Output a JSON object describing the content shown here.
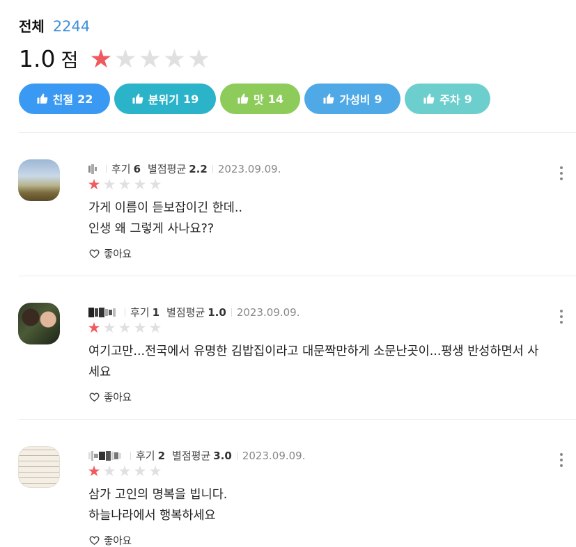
{
  "summary": {
    "total_label": "전체",
    "total_count": "2244",
    "score": "1.0",
    "score_unit": "점",
    "rating_stars": 1
  },
  "chips": [
    {
      "label": "친절",
      "count": "22",
      "color": "#3a9af3"
    },
    {
      "label": "분위기",
      "count": "19",
      "color": "#2bb3c9"
    },
    {
      "label": "맛",
      "count": "14",
      "color": "#8dcb5a"
    },
    {
      "label": "가성비",
      "count": "9",
      "color": "#4fa9e6"
    },
    {
      "label": "주차",
      "count": "9",
      "color": "#6dcfcd"
    }
  ],
  "labels": {
    "review_count": "후기",
    "avg_rating": "별점평균",
    "like": "좋아요"
  },
  "reviews": [
    {
      "review_count": "6",
      "avg_rating": "2.2",
      "date": "2023.09.09.",
      "stars": 1,
      "lines": [
        "가게 이름이 듣보잡이긴 한데..",
        "인생 왜 그렇게 사나요??"
      ]
    },
    {
      "review_count": "1",
      "avg_rating": "1.0",
      "date": "2023.09.09.",
      "stars": 1,
      "lines": [
        "여기고만...전국에서 유명한 김밥집이라고 대문짝만하게 소문난곳이...평생 반성하면서 사",
        "세요"
      ]
    },
    {
      "review_count": "2",
      "avg_rating": "3.0",
      "date": "2023.09.09.",
      "stars": 1,
      "lines": [
        "삼가 고인의 명복을 빕니다.",
        "하늘나라에서 행복하세요"
      ]
    }
  ],
  "icons": {
    "chip_icon": "thumbs-up-icon",
    "like_icon": "heart-outline-icon",
    "more_icon": "more-vertical-icon",
    "star_icon": "star-icon"
  },
  "colors": {
    "accent_blue": "#3d8fd8",
    "star_on": "#f05a5e",
    "star_off": "#e0e0e0"
  }
}
